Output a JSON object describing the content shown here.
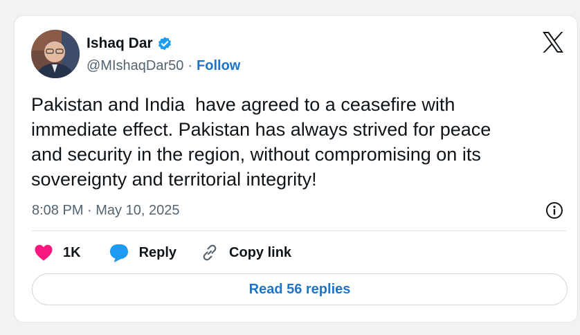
{
  "user": {
    "name": "Ishaq Dar",
    "handle": "@MIshaqDar50",
    "separator": "·",
    "follow_label": "Follow"
  },
  "tweet": {
    "text": "Pakistan and India  have agreed to a ceasefire with\nimmediate effect. Pakistan has always strived for peace\nand security in the region, without compromising on its\nsovereignty and territorial integrity!",
    "timestamp": "8:08 PM · May 10, 2025"
  },
  "actions": {
    "like_count": "1K",
    "reply_label": "Reply",
    "copy_label": "Copy link"
  },
  "read_replies_label": "Read 56 replies",
  "colors": {
    "accent": "#1d74c9",
    "verified": "#1d9bf0",
    "like": "#f91880"
  },
  "icons": [
    "x-logo-icon",
    "verified-badge-icon",
    "info-icon",
    "heart-icon",
    "reply-bubble-icon",
    "link-icon"
  ]
}
